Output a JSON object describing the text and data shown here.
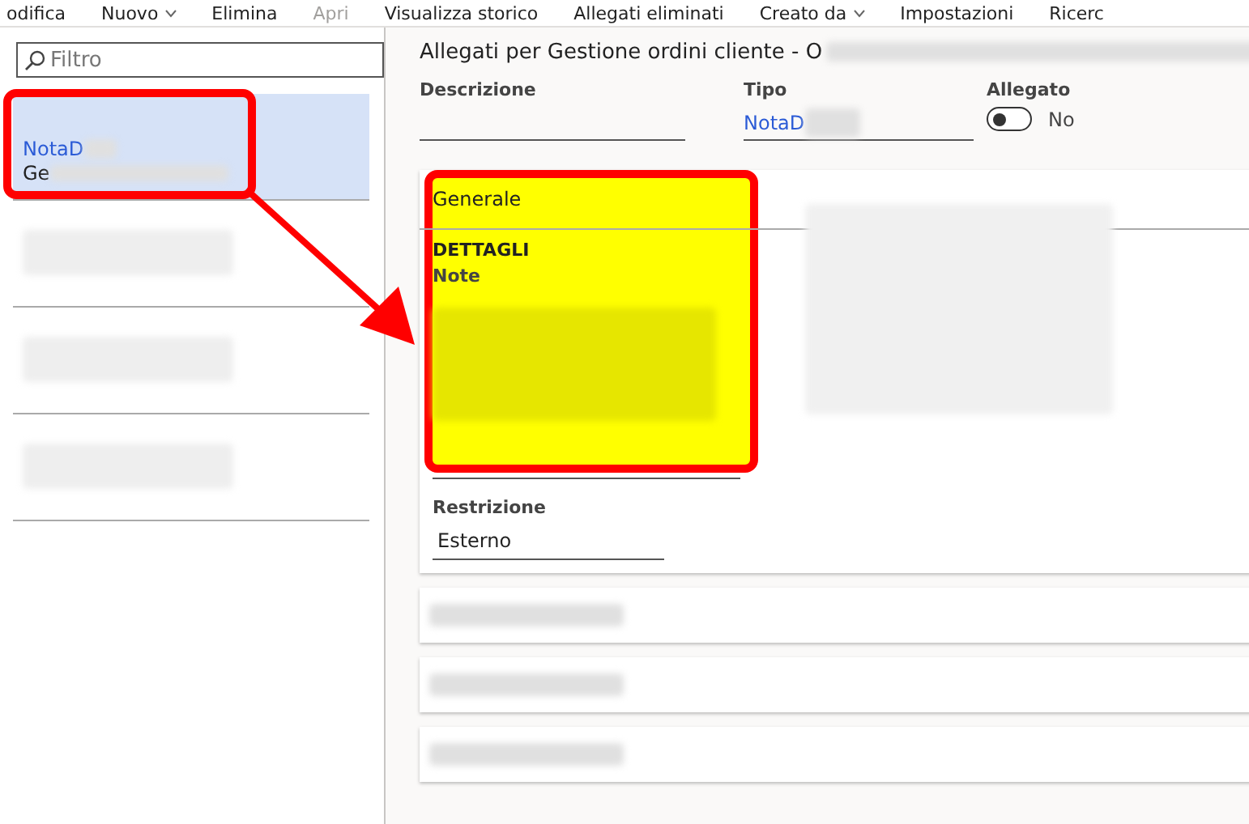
{
  "toolbar": [
    {
      "label": "odifica",
      "disabled": false,
      "menu": false
    },
    {
      "label": "Nuovo",
      "disabled": false,
      "menu": true
    },
    {
      "label": "Elimina",
      "disabled": false,
      "menu": false
    },
    {
      "label": "Apri",
      "disabled": true,
      "menu": false
    },
    {
      "label": "Visualizza storico",
      "disabled": false,
      "menu": false
    },
    {
      "label": "Allegati eliminati",
      "disabled": false,
      "menu": false
    },
    {
      "label": "Creato da",
      "disabled": false,
      "menu": true
    },
    {
      "label": "Impostazioni",
      "disabled": false,
      "menu": false
    },
    {
      "label": "Ricerc",
      "disabled": false,
      "menu": false
    }
  ],
  "filter": {
    "placeholder": "Filtro"
  },
  "list": [
    {
      "title": "NotaD",
      "subtitle": "Ge",
      "selected": true
    },
    {
      "selected": false
    },
    {
      "selected": false
    },
    {
      "selected": false
    }
  ],
  "title": "Allegati per Gestione ordini cliente - O",
  "fields": {
    "descrizione": {
      "label": "Descrizione"
    },
    "tipo": {
      "label": "Tipo",
      "value": "NotaD"
    },
    "allegato": {
      "label": "Allegato",
      "on": false,
      "state_text": "No"
    }
  },
  "sections": [
    {
      "title": "Generale",
      "expanded": true,
      "group": "DETTAGLI",
      "note_label": "Note",
      "restriction_label": "Restrizione",
      "restriction_value": "Esterno"
    },
    {
      "expanded": false
    },
    {
      "expanded": false
    },
    {
      "expanded": false
    }
  ]
}
